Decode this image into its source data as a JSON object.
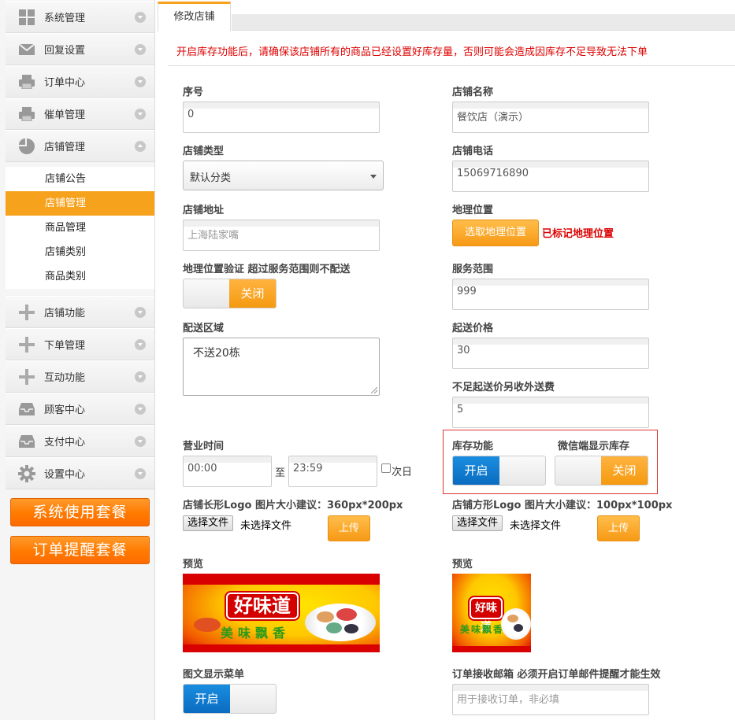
{
  "sidebar": {
    "menu": [
      {
        "label": "系统管理",
        "icon": "grid-icon"
      },
      {
        "label": "回复设置",
        "icon": "mail-icon"
      },
      {
        "label": "订单中心",
        "icon": "printer-icon"
      },
      {
        "label": "催单管理",
        "icon": "printer-icon"
      },
      {
        "label": "店铺管理",
        "icon": "pie-chart-icon"
      },
      {
        "label": "店铺功能",
        "icon": "plus-icon"
      },
      {
        "label": "下单管理",
        "icon": "plus-icon"
      },
      {
        "label": "互动功能",
        "icon": "plus-icon"
      },
      {
        "label": "顾客中心",
        "icon": "inbox-icon"
      },
      {
        "label": "支付中心",
        "icon": "inbox-icon"
      },
      {
        "label": "设置中心",
        "icon": "gear-icon"
      }
    ],
    "submenu": [
      "店铺公告",
      "店铺管理",
      "商品管理",
      "店铺类别",
      "商品类别"
    ],
    "active_sub": "店铺管理",
    "buttons": [
      "系统使用套餐",
      "订单提醒套餐"
    ]
  },
  "tab": "修改店铺",
  "notice": "开启库存功能后，请确保该店铺所有的商品已经设置好库存量，否则可能会造成因库存不足导致无法下单",
  "form": {
    "seq_label": "序号",
    "seq_value": "0",
    "name_label": "店铺名称",
    "name_value": "餐饮店（演示）",
    "type_label": "店铺类型",
    "type_value": "默认分类",
    "phone_label": "店铺电话",
    "phone_value": "15069716890",
    "addr_label": "店铺地址",
    "addr_value": "上海陆家嘴",
    "geo_label": "地理位置",
    "geo_button": "选取地理位置",
    "geo_status": "已标记地理位置",
    "geo_verify_label": "地理位置验证 超过服务范围则不配送",
    "geo_verify_state": "关闭",
    "range_label": "服务范围",
    "range_value": "999",
    "area_label": "配送区域",
    "area_value": "不送20栋",
    "minprice_label": "起送价格",
    "minprice_value": "30",
    "extra_fee_label": "不足起送价另收外送费",
    "extra_fee_value": "5",
    "hours_label": "营业时间",
    "hours_start": "00:00",
    "hours_sep": "至",
    "hours_end": "23:59",
    "next_day": "次日",
    "stock_label": "库存功能",
    "stock_state": "开启",
    "wx_stock_label": "微信端显示库存",
    "wx_stock_state": "关闭",
    "long_logo_label": "店铺长形Logo 图片大小建议：360px*200px",
    "square_logo_label": "店铺方形Logo 图片大小建议：100px*100px",
    "choose_file": "选择文件",
    "no_file": "未选择文件",
    "upload": "上传",
    "preview_label": "预览",
    "logo_text": "好味道",
    "logo_sub": "美味飘香",
    "menu_label": "图文显示菜单",
    "menu_state": "开启",
    "email_label": "订单接收邮箱  必须开启订单邮件提醒才能生效",
    "email_placeholder": "用于接收订单，非必填"
  },
  "colors": {
    "accent": "#f7a21c",
    "notice": "#dd0000",
    "on": "#0a6cc0"
  }
}
